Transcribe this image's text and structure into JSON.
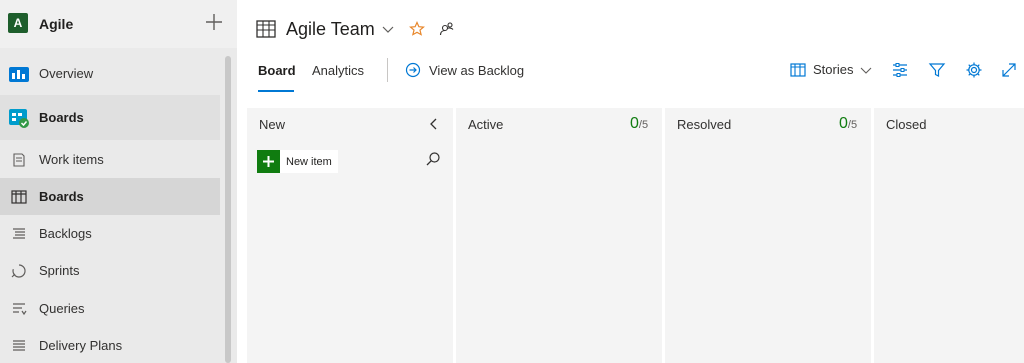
{
  "project": {
    "initial": "A",
    "name": "Agile"
  },
  "nav": {
    "overview": "Overview",
    "boards_hub": "Boards",
    "work_items": "Work items",
    "boards": "Boards",
    "backlogs": "Backlogs",
    "sprints": "Sprints",
    "queries": "Queries",
    "delivery_plans": "Delivery Plans"
  },
  "header": {
    "title": "Agile Team",
    "tabs": {
      "board": "Board",
      "analytics": "Analytics"
    },
    "view_as_backlog": "View as Backlog",
    "backlog_level": "Stories"
  },
  "columns": [
    {
      "title": "New"
    },
    {
      "title": "Active",
      "count": "0",
      "limit": "/5"
    },
    {
      "title": "Resolved",
      "count": "0",
      "limit": "/5"
    },
    {
      "title": "Closed"
    }
  ],
  "new_item": {
    "label": "New item"
  },
  "colors": {
    "accent": "#0078d4",
    "count_green": "#107c10",
    "project_avatar": "#1e5e2c",
    "star": "#e8872b"
  },
  "icons": [
    "plus-icon",
    "overview-icon",
    "boards-hub-icon",
    "work-items-icon",
    "boards-icon",
    "backlogs-icon",
    "sprints-icon",
    "queries-icon",
    "delivery-plans-icon",
    "star-icon",
    "people-icon",
    "arrow-circle-icon",
    "settings-sliders-icon",
    "filter-icon",
    "gear-icon",
    "expand-icon",
    "search-icon",
    "chevron-left-icon"
  ]
}
